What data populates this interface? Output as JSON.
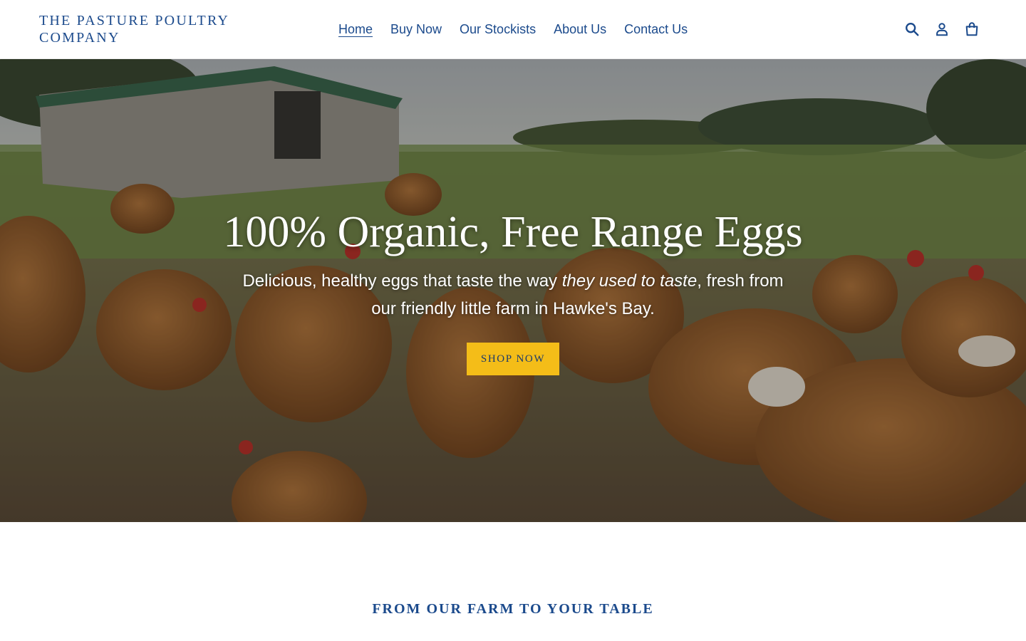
{
  "brand": {
    "name_line1": "THE PASTURE POULTRY",
    "name_line2": "COMPANY",
    "primary_color": "#1b4a8c",
    "accent_color": "#f4bd18"
  },
  "nav": {
    "items": [
      {
        "label": "Home",
        "active": true
      },
      {
        "label": "Buy Now",
        "active": false
      },
      {
        "label": "Our Stockists",
        "active": false
      },
      {
        "label": "About Us",
        "active": false
      },
      {
        "label": "Contact Us",
        "active": false
      }
    ]
  },
  "header_icons": [
    "search-icon",
    "account-icon",
    "cart-icon"
  ],
  "hero": {
    "title": "100% Organic, Free Range Eggs",
    "subtitle_before": "Delicious, healthy eggs that taste the way ",
    "subtitle_emphasis": "they used to taste",
    "subtitle_after": ", fresh from our friendly little farm in Hawke's Bay.",
    "cta_label": "SHOP NOW"
  },
  "section": {
    "heading": "FROM OUR FARM TO YOUR TABLE"
  }
}
